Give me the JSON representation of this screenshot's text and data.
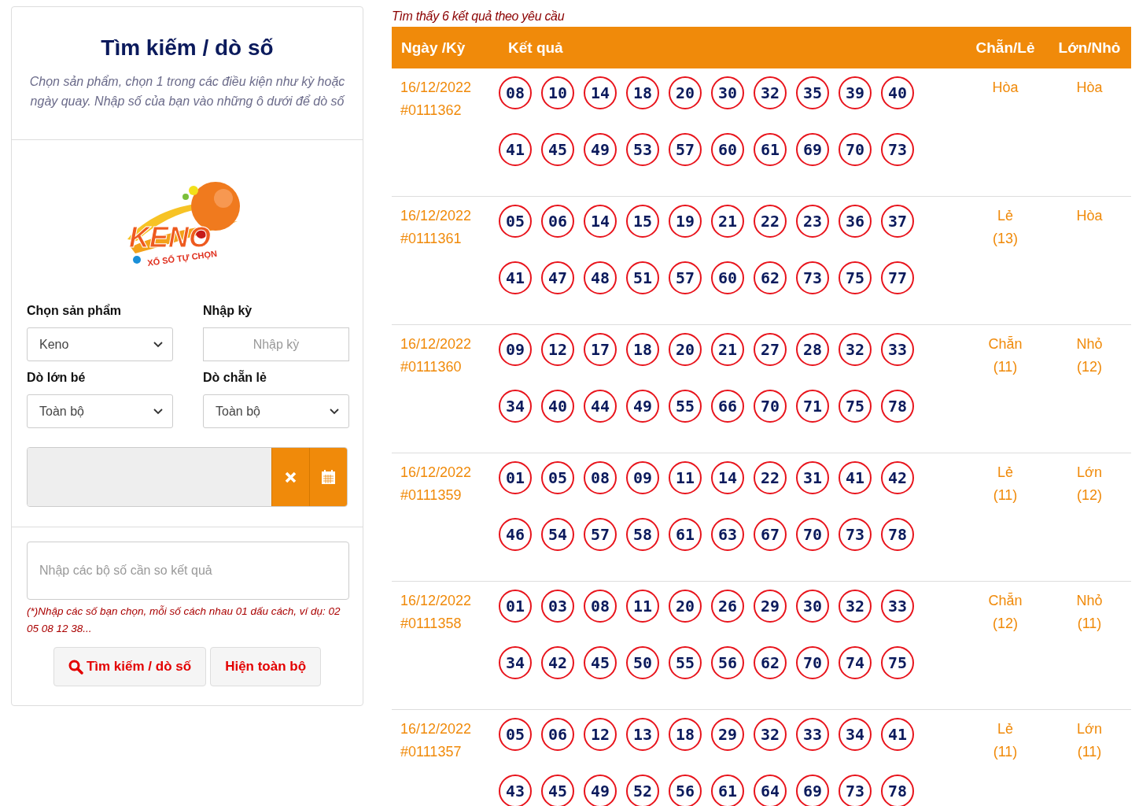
{
  "search_panel": {
    "title": "Tìm kiếm / dò số",
    "description": "Chọn sản phẩm, chọn 1 trong các điều kiện như kỳ hoặc ngày quay. Nhập số của bạn vào những ô dưới để dò số",
    "logo": {
      "name": "KENO",
      "tagline": "XỔ SỐ TỰ CHỌN"
    },
    "fields": [
      {
        "label": "Chọn sản phẩm",
        "kind": "select",
        "value": "Keno"
      },
      {
        "label": "Nhập kỳ",
        "kind": "text",
        "placeholder": "Nhập kỳ"
      },
      {
        "label": "Dò lớn bé",
        "kind": "select",
        "value": "Toàn bộ"
      },
      {
        "label": "Dò chẵn lẻ",
        "kind": "select",
        "value": "Toàn bộ"
      }
    ],
    "numbers_field": {
      "placeholder": "Nhập các bộ số cần so kết quả"
    },
    "hint": "(*)Nhập các số bạn chọn, mỗi số cách nhau 01 dấu cách, ví dụ: 02 05 08 12 38...",
    "buttons": [
      {
        "label": "Tìm kiếm / dò số",
        "kind": "search"
      },
      {
        "label": "Hiện toàn bộ",
        "kind": "plain"
      }
    ]
  },
  "results": {
    "summary": "Tìm thấy 6 kết quả theo yêu cầu",
    "columns": [
      "Ngày /Kỳ",
      "Kết quả",
      "Chẵn/Lẻ",
      "Lớn/Nhỏ"
    ],
    "rows": [
      {
        "date": "16/12/2022",
        "draw": "#0111362",
        "numbers": [
          "08",
          "10",
          "14",
          "18",
          "20",
          "30",
          "32",
          "35",
          "39",
          "40",
          "41",
          "45",
          "49",
          "53",
          "57",
          "60",
          "61",
          "69",
          "70",
          "73"
        ],
        "parity": "Hòa",
        "size": "Hòa"
      },
      {
        "date": "16/12/2022",
        "draw": "#0111361",
        "numbers": [
          "05",
          "06",
          "14",
          "15",
          "19",
          "21",
          "22",
          "23",
          "36",
          "37",
          "41",
          "47",
          "48",
          "51",
          "57",
          "60",
          "62",
          "73",
          "75",
          "77"
        ],
        "parity": "Lẻ",
        "parity_count": "(13)",
        "size": "Hòa"
      },
      {
        "date": "16/12/2022",
        "draw": "#0111360",
        "numbers": [
          "09",
          "12",
          "17",
          "18",
          "20",
          "21",
          "27",
          "28",
          "32",
          "33",
          "34",
          "40",
          "44",
          "49",
          "55",
          "66",
          "70",
          "71",
          "75",
          "78"
        ],
        "parity": "Chẵn",
        "parity_count": "(11)",
        "size": "Nhỏ",
        "size_count": "(12)"
      },
      {
        "date": "16/12/2022",
        "draw": "#0111359",
        "numbers": [
          "01",
          "05",
          "08",
          "09",
          "11",
          "14",
          "22",
          "31",
          "41",
          "42",
          "46",
          "54",
          "57",
          "58",
          "61",
          "63",
          "67",
          "70",
          "73",
          "78"
        ],
        "parity": "Lẻ",
        "parity_count": "(11)",
        "size": "Lớn",
        "size_count": "(12)"
      },
      {
        "date": "16/12/2022",
        "draw": "#0111358",
        "numbers": [
          "01",
          "03",
          "08",
          "11",
          "20",
          "26",
          "29",
          "30",
          "32",
          "33",
          "34",
          "42",
          "45",
          "50",
          "55",
          "56",
          "62",
          "70",
          "74",
          "75"
        ],
        "parity": "Chẵn",
        "parity_count": "(12)",
        "size": "Nhỏ",
        "size_count": "(11)"
      },
      {
        "date": "16/12/2022",
        "draw": "#0111357",
        "numbers": [
          "05",
          "06",
          "12",
          "13",
          "18",
          "29",
          "32",
          "33",
          "34",
          "41",
          "43",
          "45",
          "49",
          "52",
          "56",
          "61",
          "64",
          "69",
          "73",
          "78"
        ],
        "parity": "Lẻ",
        "parity_count": "(11)",
        "size": "Lớn",
        "size_count": "(11)"
      }
    ]
  }
}
